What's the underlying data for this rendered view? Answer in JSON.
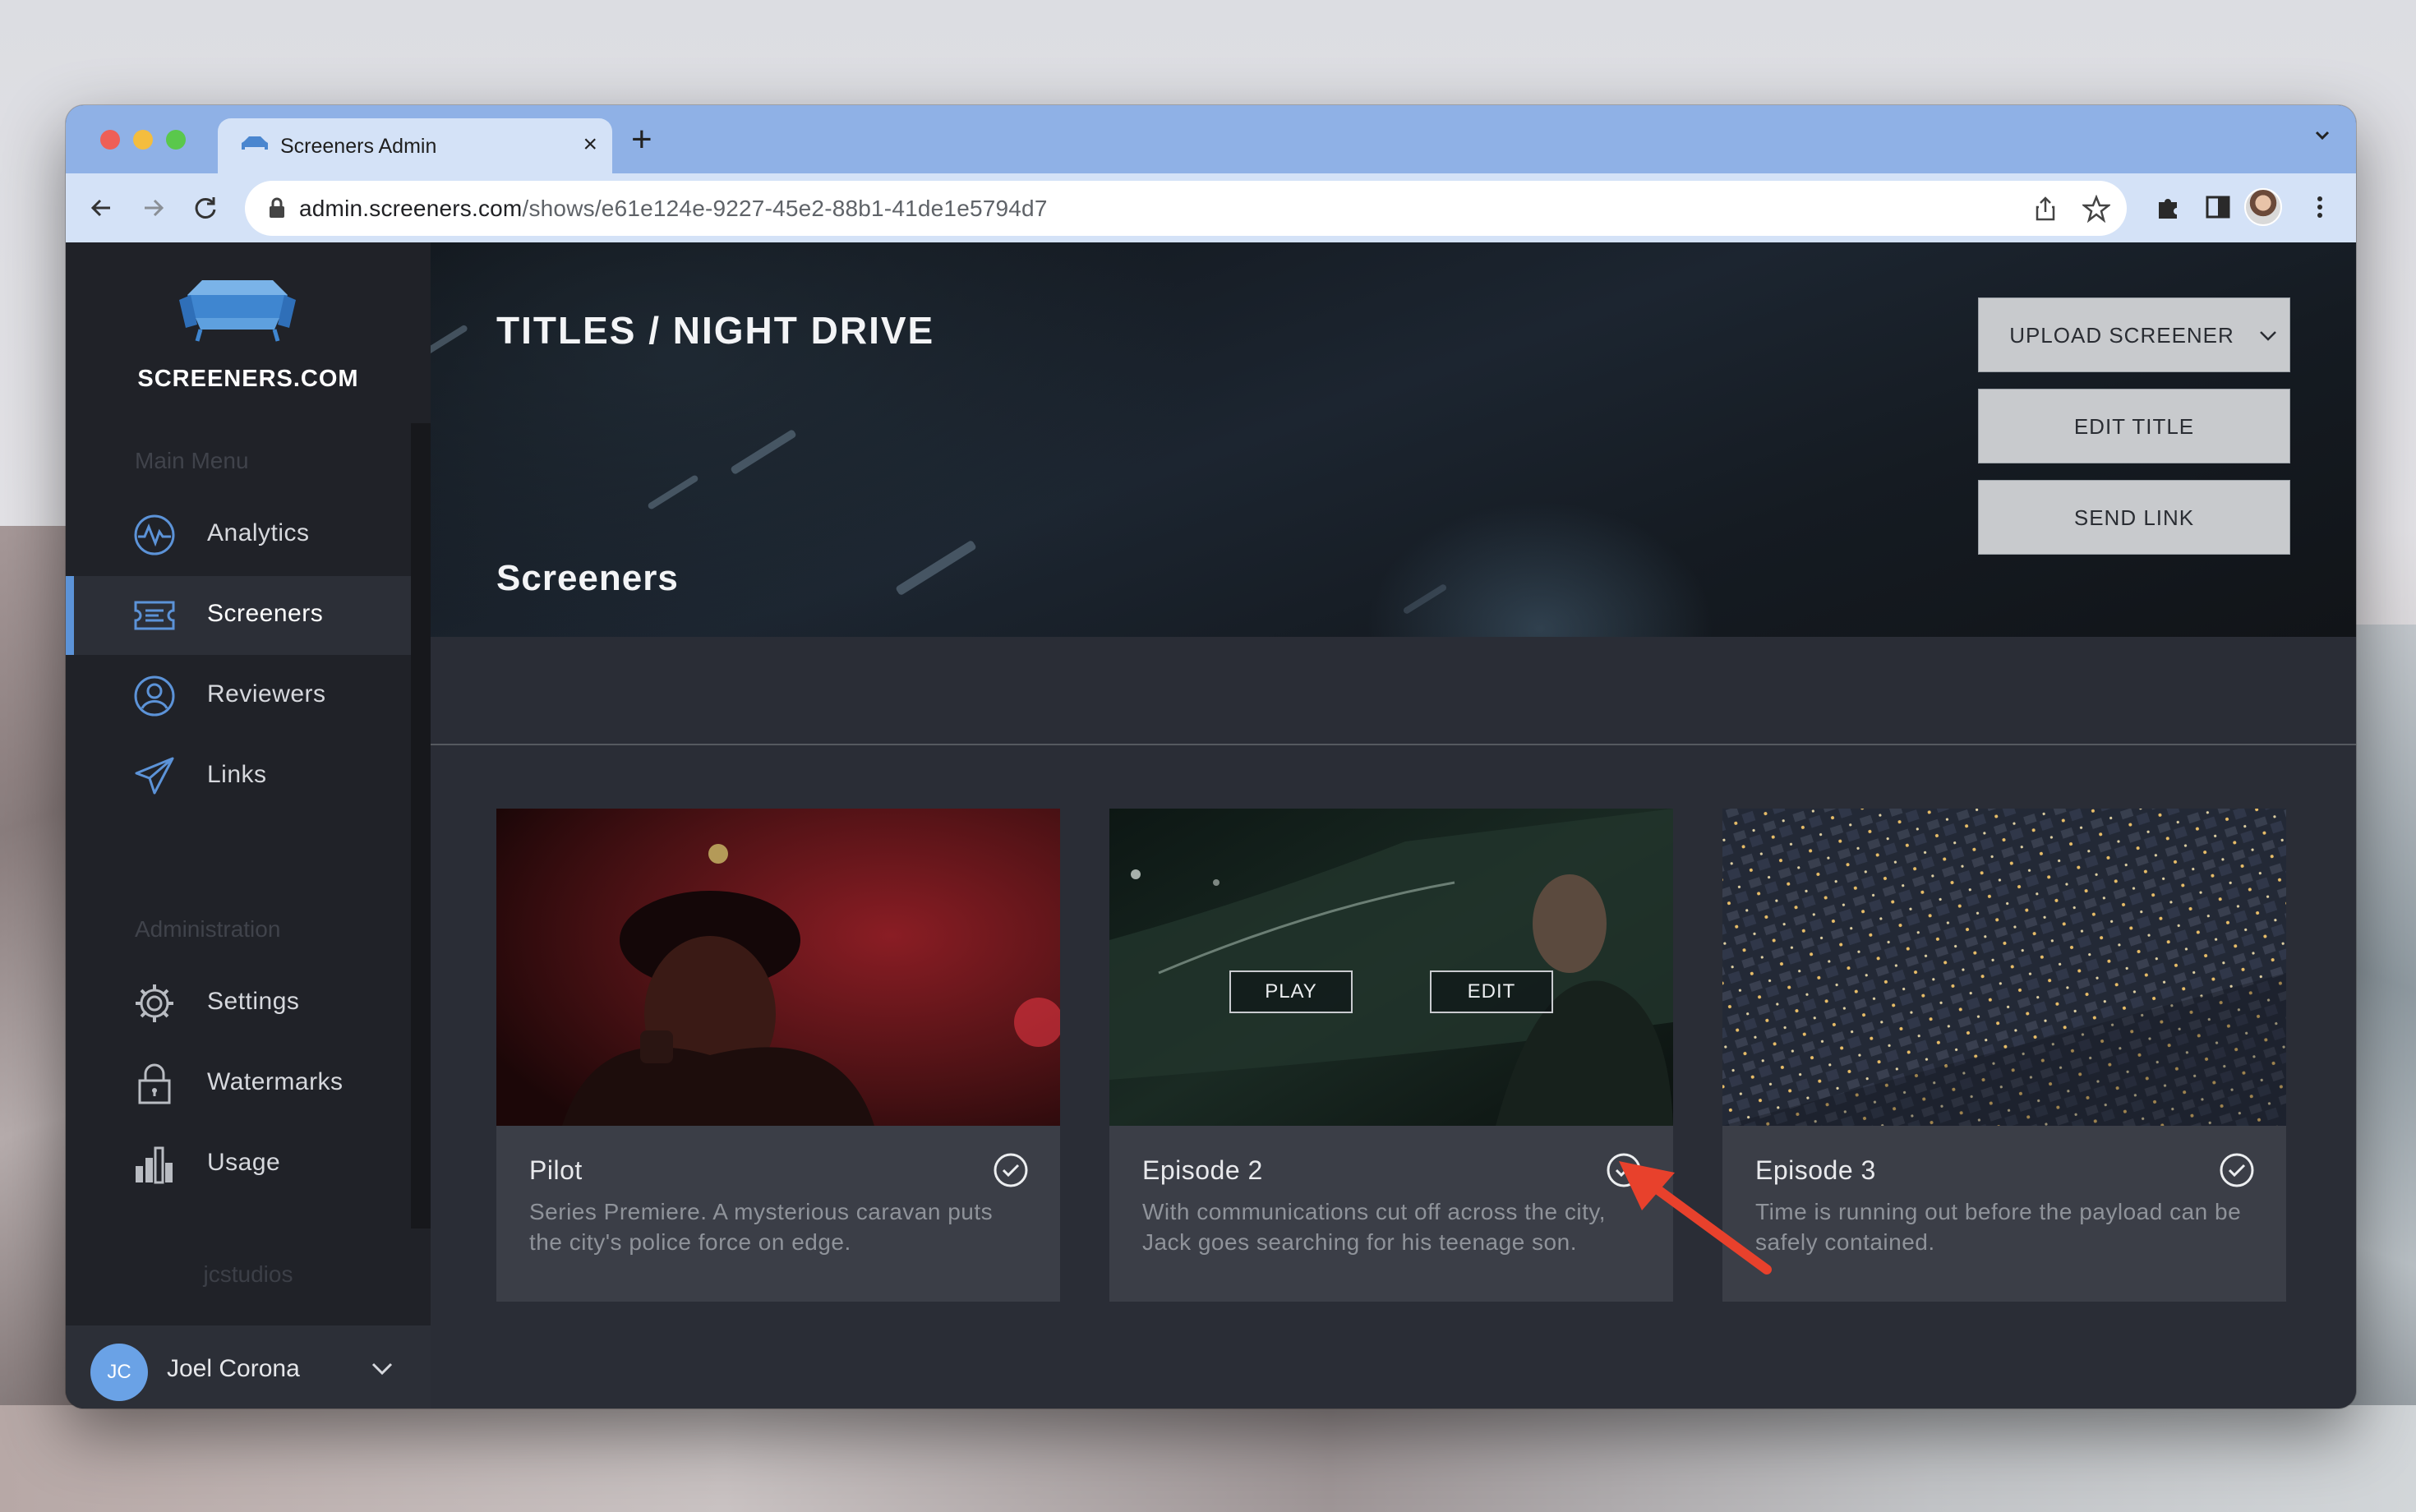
{
  "browser": {
    "tab_title": "Screeners Admin",
    "tab_close": "×",
    "new_tab": "+",
    "url_host": "admin.screeners.com",
    "url_path": "/shows/e61e124e-9227-45e2-88b1-41de1e5794d7"
  },
  "sidebar": {
    "brand": "SCREENERS.COM",
    "main_menu_label": "Main Menu",
    "main_items": [
      {
        "label": "Analytics",
        "icon": "analytics-icon"
      },
      {
        "label": "Screeners",
        "icon": "ticket-icon"
      },
      {
        "label": "Reviewers",
        "icon": "user-circle-icon"
      },
      {
        "label": "Links",
        "icon": "paper-plane-icon"
      }
    ],
    "admin_label": "Administration",
    "admin_items": [
      {
        "label": "Settings",
        "icon": "gear-icon"
      },
      {
        "label": "Watermarks",
        "icon": "lock-icon"
      },
      {
        "label": "Usage",
        "icon": "bar-chart-icon"
      }
    ],
    "tenant": "jcstudios",
    "user": {
      "initials": "JC",
      "name": "Joel Corona"
    }
  },
  "main": {
    "breadcrumb": "TITLES / NIGHT DRIVE",
    "section_title": "Screeners",
    "buttons": {
      "upload": "UPLOAD SCREENER",
      "edit_title": "EDIT TITLE",
      "send_link": "SEND LINK"
    },
    "cards": [
      {
        "title": "Pilot",
        "description": "Series Premiere. A mysterious caravan puts the city's police force on edge."
      },
      {
        "title": "Episode 2",
        "description": "With communications cut off across the city, Jack goes searching for his teenage son.",
        "play_label": "PLAY",
        "edit_label": "EDIT"
      },
      {
        "title": "Episode 3",
        "description": "Time is running out before the payload can be safely contained."
      }
    ]
  },
  "colors": {
    "accent": "#5c93d8",
    "annotation_arrow": "#e8412c",
    "chat_button": "#6ea3e8"
  }
}
